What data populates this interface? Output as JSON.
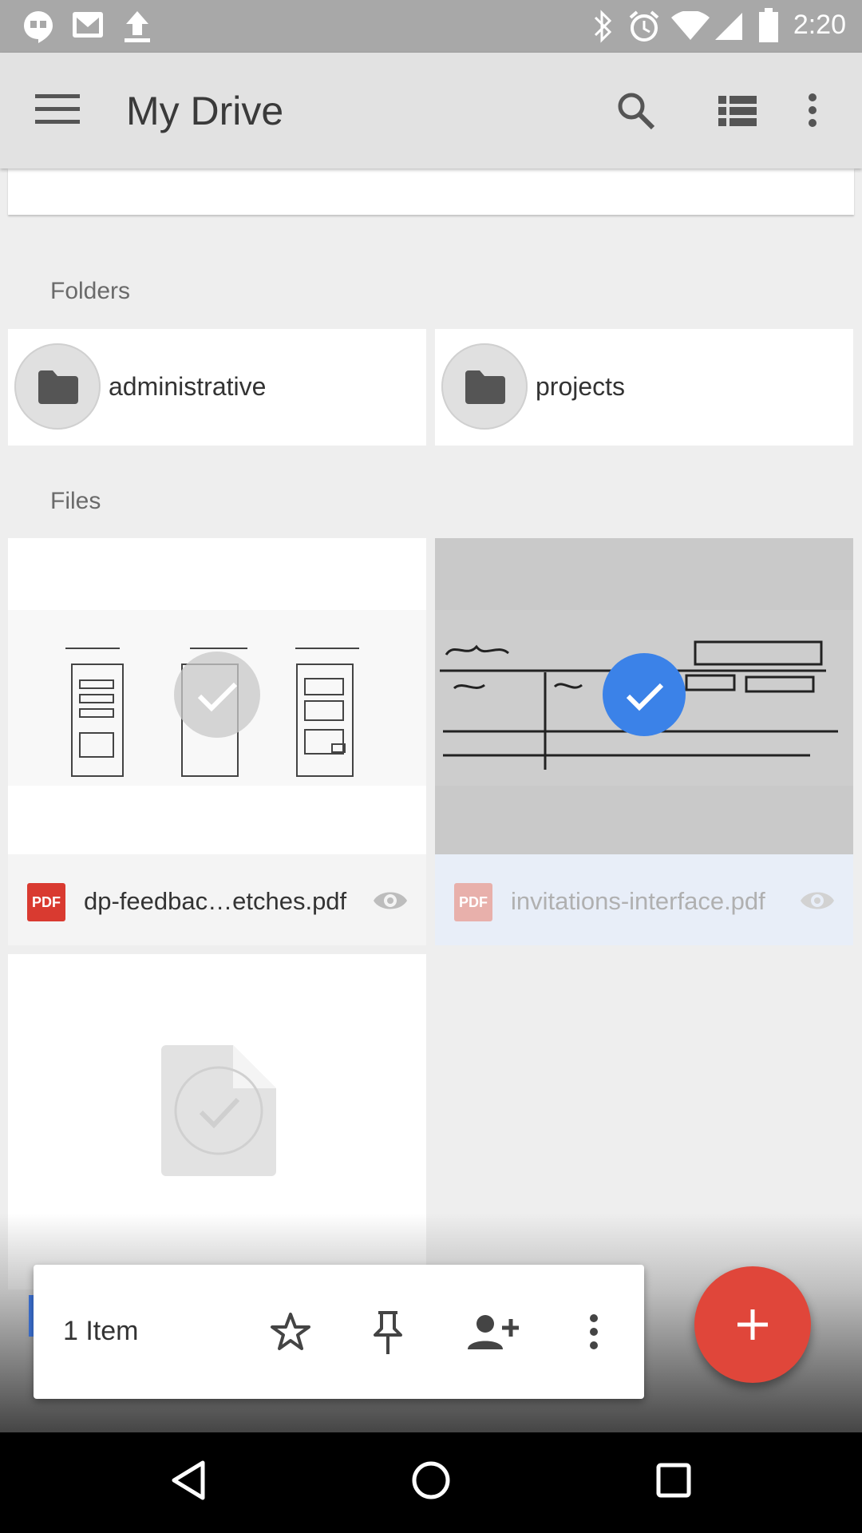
{
  "status_bar": {
    "time": "2:20"
  },
  "app_bar": {
    "title": "My Drive"
  },
  "sections": {
    "folders_label": "Folders",
    "files_label": "Files"
  },
  "folders": [
    {
      "name": "administrative"
    },
    {
      "name": "projects"
    }
  ],
  "files": [
    {
      "name": "dp-feedbac…etches.pdf",
      "type": "PDF",
      "selected": false
    },
    {
      "name": "invitations-interface.pdf",
      "type": "PDF",
      "selected": true
    }
  ],
  "action_bar": {
    "count_label": "1 Item"
  },
  "colors": {
    "accent_blue": "#3b82e8",
    "fab_red": "#e0463a",
    "pdf_red": "#d93a30"
  }
}
